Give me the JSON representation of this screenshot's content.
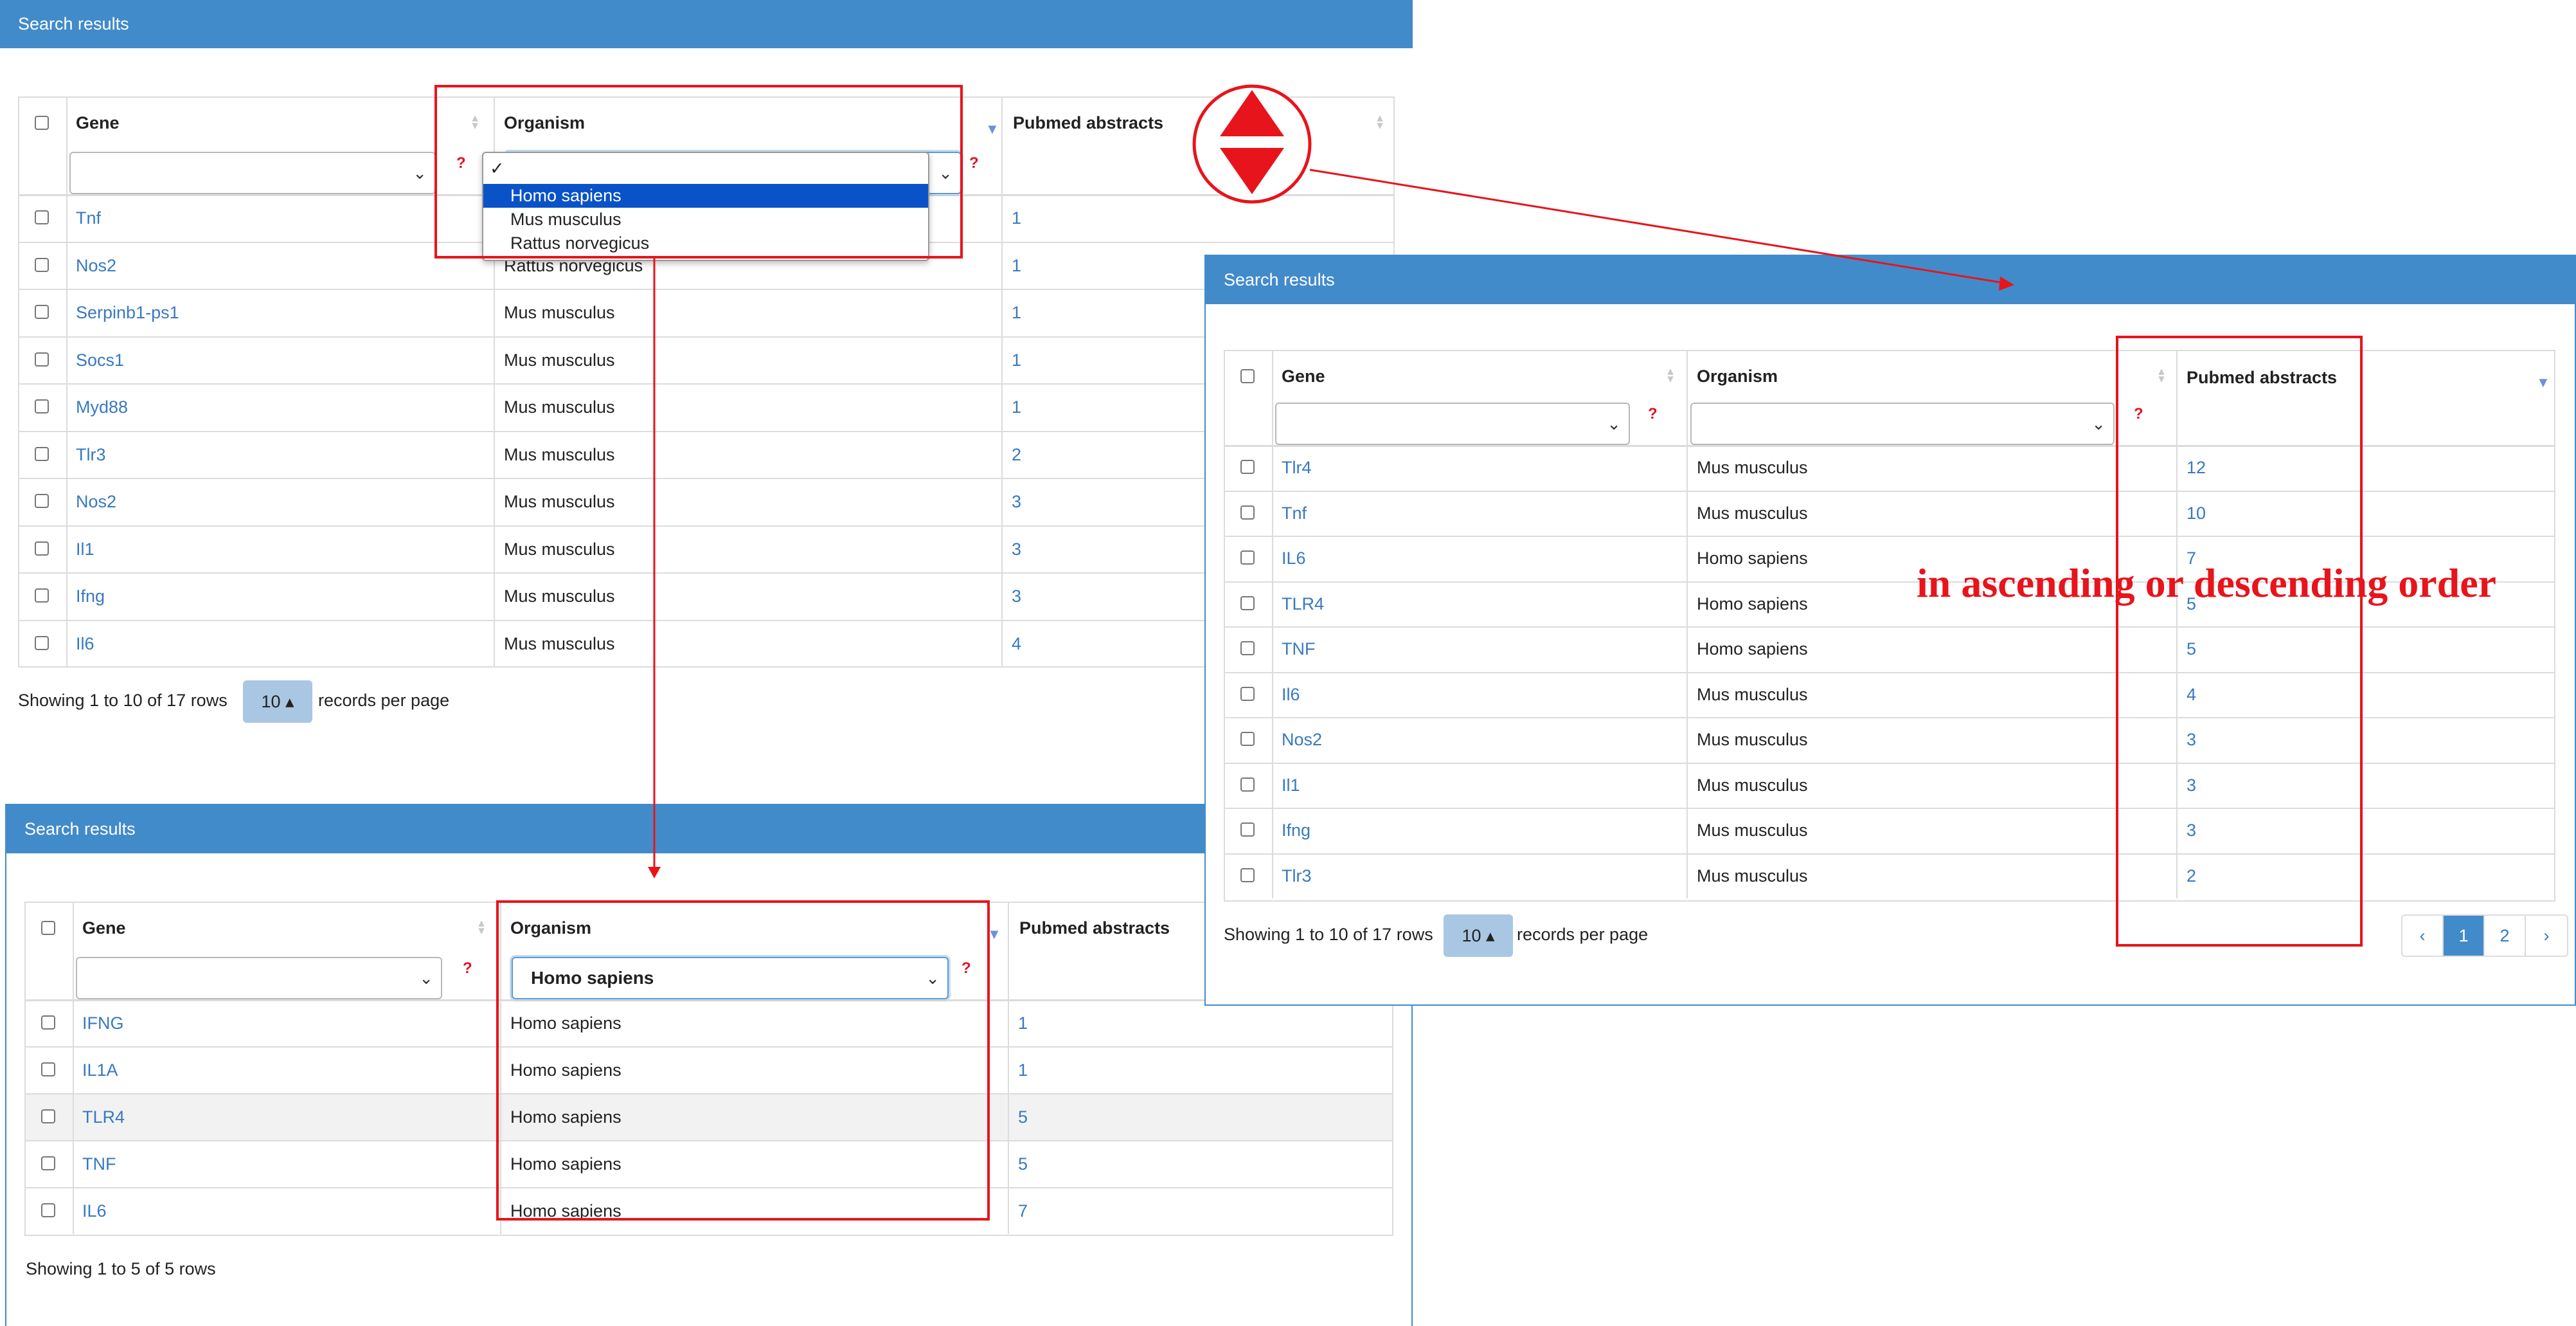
{
  "colors": {
    "header_bg": "#428bca",
    "link": "#3779c0",
    "annotation_red": "#e8141c",
    "option_selected": "#0a52c7"
  },
  "panel1": {
    "title": "Search results",
    "columns": {
      "gene": "Gene",
      "organism": "Organism",
      "pubmed": "Pubmed abstracts"
    },
    "help_mark": "?",
    "organism_dropdown": {
      "check": "✓",
      "options": [
        "Homo sapiens",
        "Mus musculus",
        "Rattus norvegicus"
      ],
      "selected": "Homo sapiens"
    },
    "rows": [
      {
        "gene": "Tnf",
        "organism": "",
        "pubmed": "1"
      },
      {
        "gene": "Nos2",
        "organism": "Rattus norvegicus",
        "pubmed": "1"
      },
      {
        "gene": "Serpinb1-ps1",
        "organism": "Mus musculus",
        "pubmed": "1"
      },
      {
        "gene": "Socs1",
        "organism": "Mus musculus",
        "pubmed": "1"
      },
      {
        "gene": "Myd88",
        "organism": "Mus musculus",
        "pubmed": "1"
      },
      {
        "gene": "Tlr3",
        "organism": "Mus musculus",
        "pubmed": "2"
      },
      {
        "gene": "Nos2",
        "organism": "Mus musculus",
        "pubmed": "3"
      },
      {
        "gene": "Il1",
        "organism": "Mus musculus",
        "pubmed": "3"
      },
      {
        "gene": "Ifng",
        "organism": "Mus musculus",
        "pubmed": "3"
      },
      {
        "gene": "Il6",
        "organism": "Mus musculus",
        "pubmed": "4"
      }
    ],
    "footer": {
      "showing": "Showing 1 to 10 of 17 rows",
      "page_size": "10 ▴",
      "records_per_page": "records per page"
    }
  },
  "panel2": {
    "title": "Search results",
    "columns": {
      "gene": "Gene",
      "organism": "Organism",
      "pubmed": "Pubmed abstracts"
    },
    "help_mark": "?",
    "organism_filter": "Homo sapiens",
    "rows": [
      {
        "gene": "IFNG",
        "organism": "Homo sapiens",
        "pubmed": "1"
      },
      {
        "gene": "IL1A",
        "organism": "Homo sapiens",
        "pubmed": "1"
      },
      {
        "gene": "TLR4",
        "organism": "Homo sapiens",
        "pubmed": "5"
      },
      {
        "gene": "TNF",
        "organism": "Homo sapiens",
        "pubmed": "5"
      },
      {
        "gene": "IL6",
        "organism": "Homo sapiens",
        "pubmed": "7"
      }
    ],
    "footer": {
      "showing": "Showing 1 to 5 of 5 rows"
    }
  },
  "panel3": {
    "title": "Search results",
    "columns": {
      "gene": "Gene",
      "organism": "Organism",
      "pubmed": "Pubmed abstracts"
    },
    "help_mark": "?",
    "rows": [
      {
        "gene": "Tlr4",
        "organism": "Mus musculus",
        "pubmed": "12"
      },
      {
        "gene": "Tnf",
        "organism": "Mus musculus",
        "pubmed": "10"
      },
      {
        "gene": "IL6",
        "organism": "Homo sapiens",
        "pubmed": "7"
      },
      {
        "gene": "TLR4",
        "organism": "Homo sapiens",
        "pubmed": "5"
      },
      {
        "gene": "TNF",
        "organism": "Homo sapiens",
        "pubmed": "5"
      },
      {
        "gene": "Il6",
        "organism": "Mus musculus",
        "pubmed": "4"
      },
      {
        "gene": "Nos2",
        "organism": "Mus musculus",
        "pubmed": "3"
      },
      {
        "gene": "Il1",
        "organism": "Mus musculus",
        "pubmed": "3"
      },
      {
        "gene": "Ifng",
        "organism": "Mus musculus",
        "pubmed": "3"
      },
      {
        "gene": "Tlr3",
        "organism": "Mus musculus",
        "pubmed": "2"
      }
    ],
    "footer": {
      "showing": "Showing 1 to 10 of 17 rows",
      "page_size": "10 ▴",
      "records_per_page": "records per page"
    },
    "pagination": {
      "prev": "‹",
      "pages": [
        "1",
        "2"
      ],
      "next": "›",
      "current": "1"
    }
  },
  "annotation": {
    "text": "in ascending or descending order",
    "icon": "sort-toggle-icon"
  }
}
